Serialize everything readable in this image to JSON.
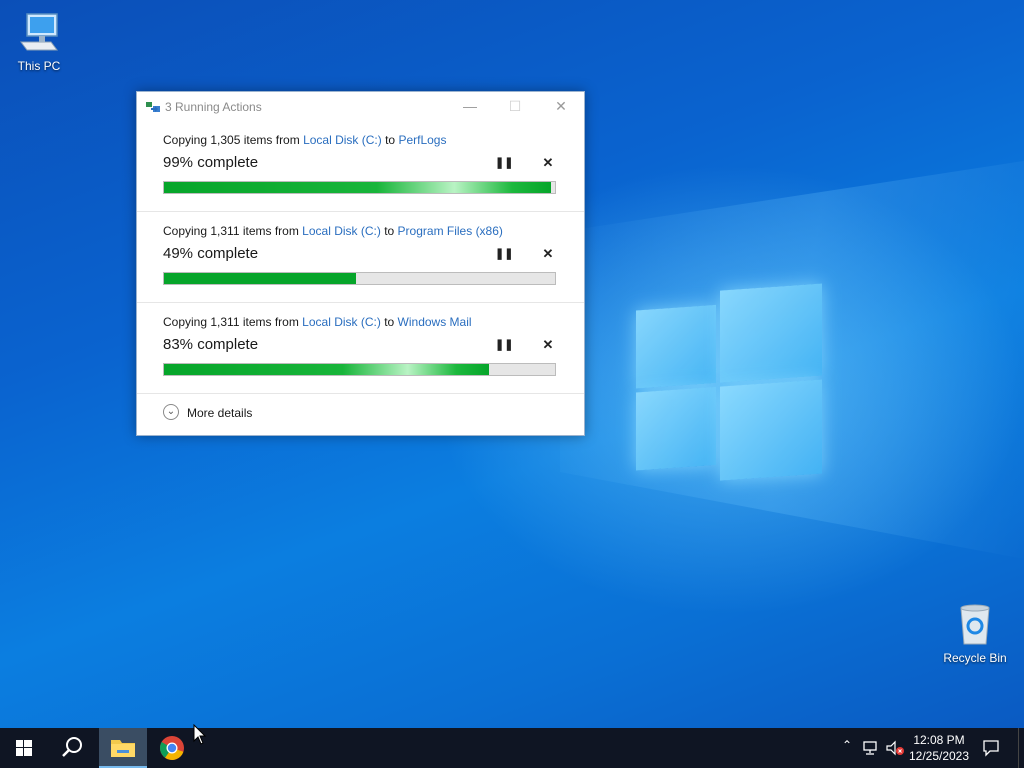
{
  "desktop": {
    "icons": [
      {
        "label": "This PC",
        "icon": "this-pc-icon"
      },
      {
        "label": "Recycle Bin",
        "icon": "recycle-bin-icon"
      }
    ]
  },
  "dialog": {
    "title": "3 Running Actions",
    "more_details": "More details",
    "tasks": [
      {
        "prefix": "Copying 1,305 items from ",
        "source": "Local Disk (C:)",
        "middle": " to ",
        "dest": "PerfLogs",
        "percent_label": "99% complete",
        "progress": 99
      },
      {
        "prefix": "Copying 1,311 items from ",
        "source": "Local Disk (C:)",
        "middle": " to ",
        "dest": "Program Files (x86)",
        "percent_label": "49% complete",
        "progress": 49
      },
      {
        "prefix": "Copying 1,311 items from ",
        "source": "Local Disk (C:)",
        "middle": " to ",
        "dest": "Windows Mail",
        "percent_label": "83% complete",
        "progress": 83
      }
    ]
  },
  "taskbar": {
    "items": [
      "start-icon",
      "search-icon",
      "file-explorer-icon",
      "chrome-icon"
    ],
    "tray_icons": [
      "chevron-up-icon",
      "network-icon",
      "volume-muted-icon",
      "notification-icon"
    ],
    "time": "12:08 PM",
    "date": "12/25/2023"
  },
  "colors": {
    "progress_green": "#06a52a",
    "link_blue": "#2a6ebf",
    "taskbar": "#0f1523"
  }
}
